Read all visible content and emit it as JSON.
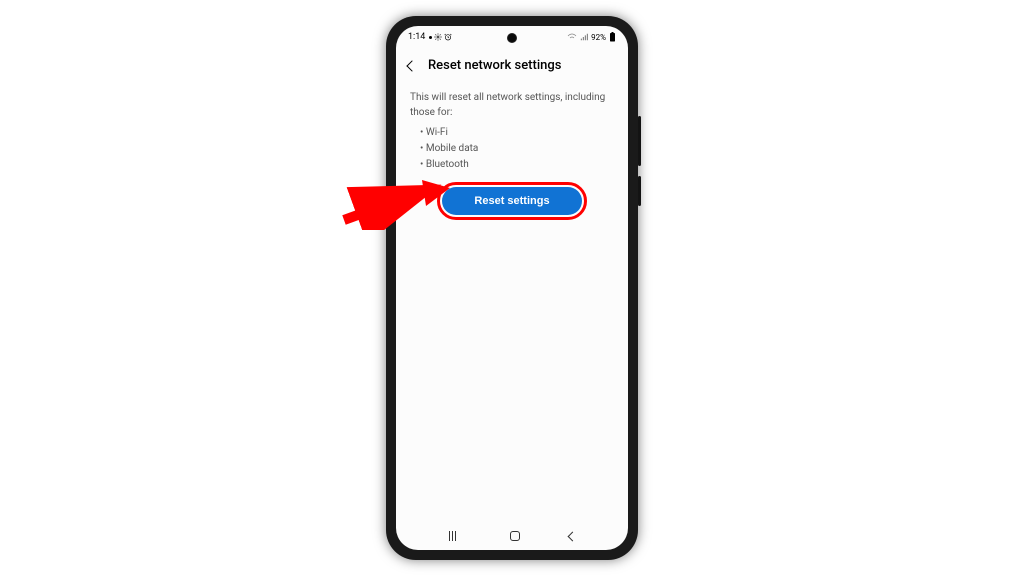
{
  "status_bar": {
    "time": "1:14",
    "battery_text": "92%"
  },
  "header": {
    "title": "Reset network settings"
  },
  "body": {
    "description": "This will reset all network settings, including those for:",
    "bullets": {
      "wifi": "Wi-Fi",
      "mobile_data": "Mobile data",
      "bluetooth": "Bluetooth"
    }
  },
  "action": {
    "reset_label": "Reset settings"
  },
  "colors": {
    "highlight": "#ff0000",
    "primary_button": "#1173d4"
  }
}
